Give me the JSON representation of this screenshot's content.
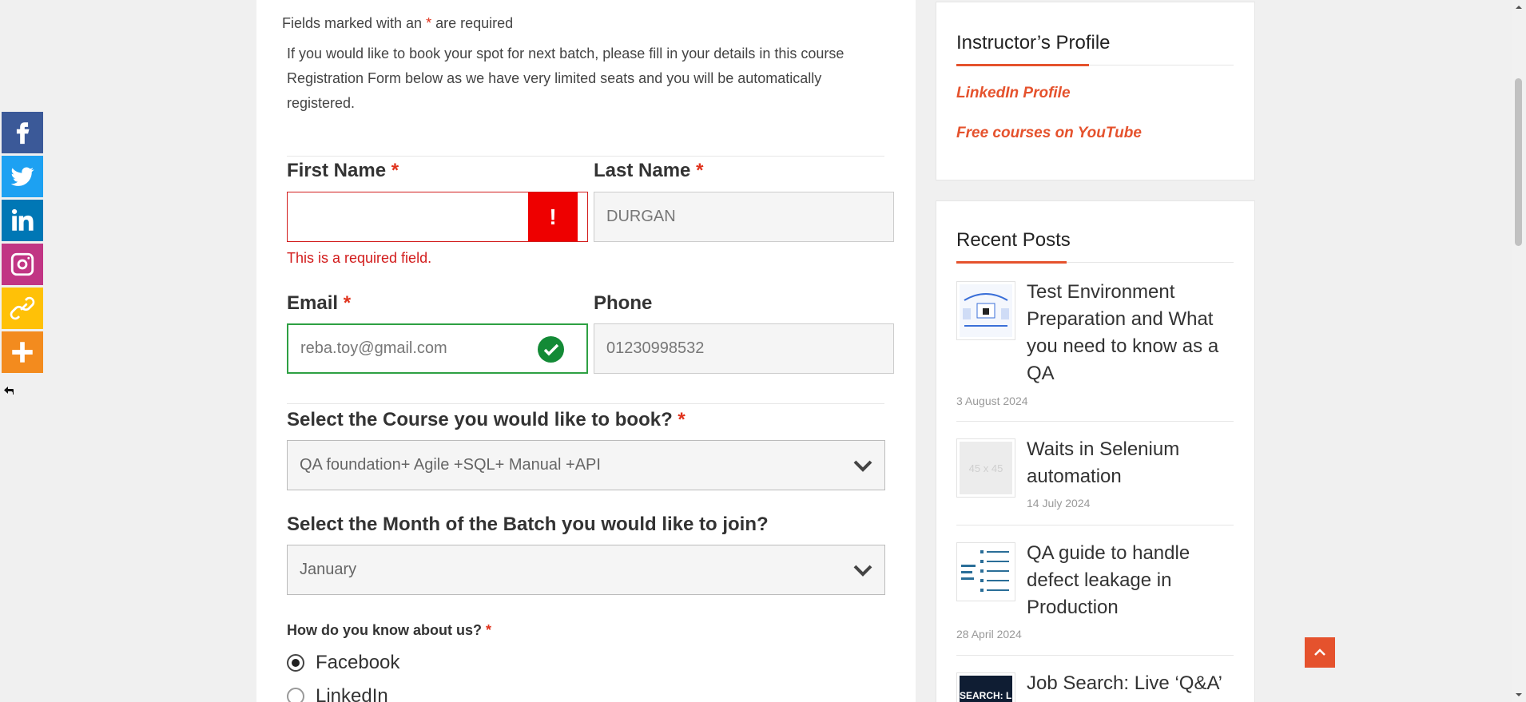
{
  "share": {
    "buttons": [
      {
        "name": "facebook",
        "color": "#3b5998",
        "icon": "facebook-icon"
      },
      {
        "name": "twitter",
        "color": "#1da1f2",
        "icon": "twitter-icon"
      },
      {
        "name": "linkedin",
        "color": "#0077b5",
        "icon": "linkedin-icon"
      },
      {
        "name": "instagram",
        "color": "#c13584",
        "icon": "instagram-icon"
      },
      {
        "name": "copy-link",
        "color": "#ffc107",
        "icon": "link-icon"
      },
      {
        "name": "more",
        "color": "#f38b1e",
        "icon": "plus-icon"
      }
    ]
  },
  "form": {
    "required_prefix": "Fields marked with an",
    "required_star": "*",
    "required_suffix": "are required",
    "intro": "If you would like to book your spot for next batch, please fill in your details in this course Registration Form below as we have very limited seats and you will be automatically registered.",
    "first_name": {
      "label": "First Name",
      "value": "",
      "error": "This is a required field.",
      "error_glyph": "!"
    },
    "last_name": {
      "label": "Last Name",
      "value": "DURGAN"
    },
    "email": {
      "label": "Email",
      "value": "reba.toy@gmail.com"
    },
    "phone": {
      "label": "Phone",
      "value": "01230998532"
    },
    "course": {
      "label": "Select the Course you would like to book?",
      "value": "QA foundation+ Agile +SQL+ Manual +API"
    },
    "month": {
      "label": "Select the Month of the Batch you would like to join?",
      "value": "January"
    },
    "source": {
      "label": "How do you know about us?",
      "options": [
        {
          "label": "Facebook",
          "checked": true
        },
        {
          "label": "LinkedIn",
          "checked": false
        }
      ]
    },
    "star": "*"
  },
  "sidebar": {
    "profile": {
      "title": "Instructor’s Profile",
      "links": [
        "LinkedIn Profile",
        "Free courses on YouTube"
      ]
    },
    "recent": {
      "title": "Recent Posts",
      "posts": [
        {
          "title": "Test Environment Preparation and What you need to know as a QA",
          "date": "3 August 2024"
        },
        {
          "title": "Waits in Selenium automation",
          "date": "14 July 2024",
          "thumb_text": "45 x 45"
        },
        {
          "title": "QA guide to handle defect leakage in Production",
          "date": "28 April 2024"
        },
        {
          "title": "Job Search: Live ‘Q&A’",
          "thumb_text": "SEARCH: LI"
        }
      ]
    }
  },
  "colors": {
    "accent": "#e5522d",
    "error": "#d21c1c",
    "valid": "#2ea043"
  }
}
